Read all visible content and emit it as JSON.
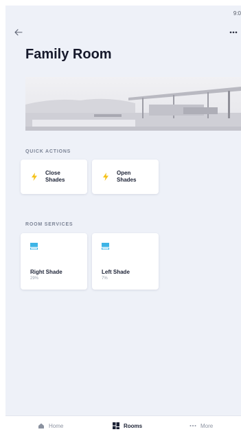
{
  "status_bar": {
    "time": "9:0"
  },
  "header": {
    "title": "Family Room"
  },
  "quick_actions": {
    "label": "QUICK ACTIONS",
    "items": [
      {
        "label_line1": "Close",
        "label_line2": "Shades",
        "icon": "lightning-bolt-icon"
      },
      {
        "label_line1": "Open",
        "label_line2": "Shades",
        "icon": "lightning-bolt-icon"
      }
    ]
  },
  "room_services": {
    "label": "ROOM SERVICES",
    "items": [
      {
        "name": "Right Shade",
        "level": "29%",
        "icon": "window-shade-icon"
      },
      {
        "name": "Left Shade",
        "level": "7%",
        "icon": "window-shade-icon"
      }
    ]
  },
  "tab_bar": {
    "items": [
      {
        "label": "Home",
        "icon": "home-icon"
      },
      {
        "label": "Rooms",
        "icon": "rooms-grid-icon"
      },
      {
        "label": "More",
        "icon": "more-dots-icon"
      }
    ],
    "active": "Rooms"
  },
  "colors": {
    "background": "#eef1f8",
    "card": "#ffffff",
    "accent_bolt": "#f5c21b",
    "shade_blue": "#3db4e6",
    "title": "#16192b"
  }
}
